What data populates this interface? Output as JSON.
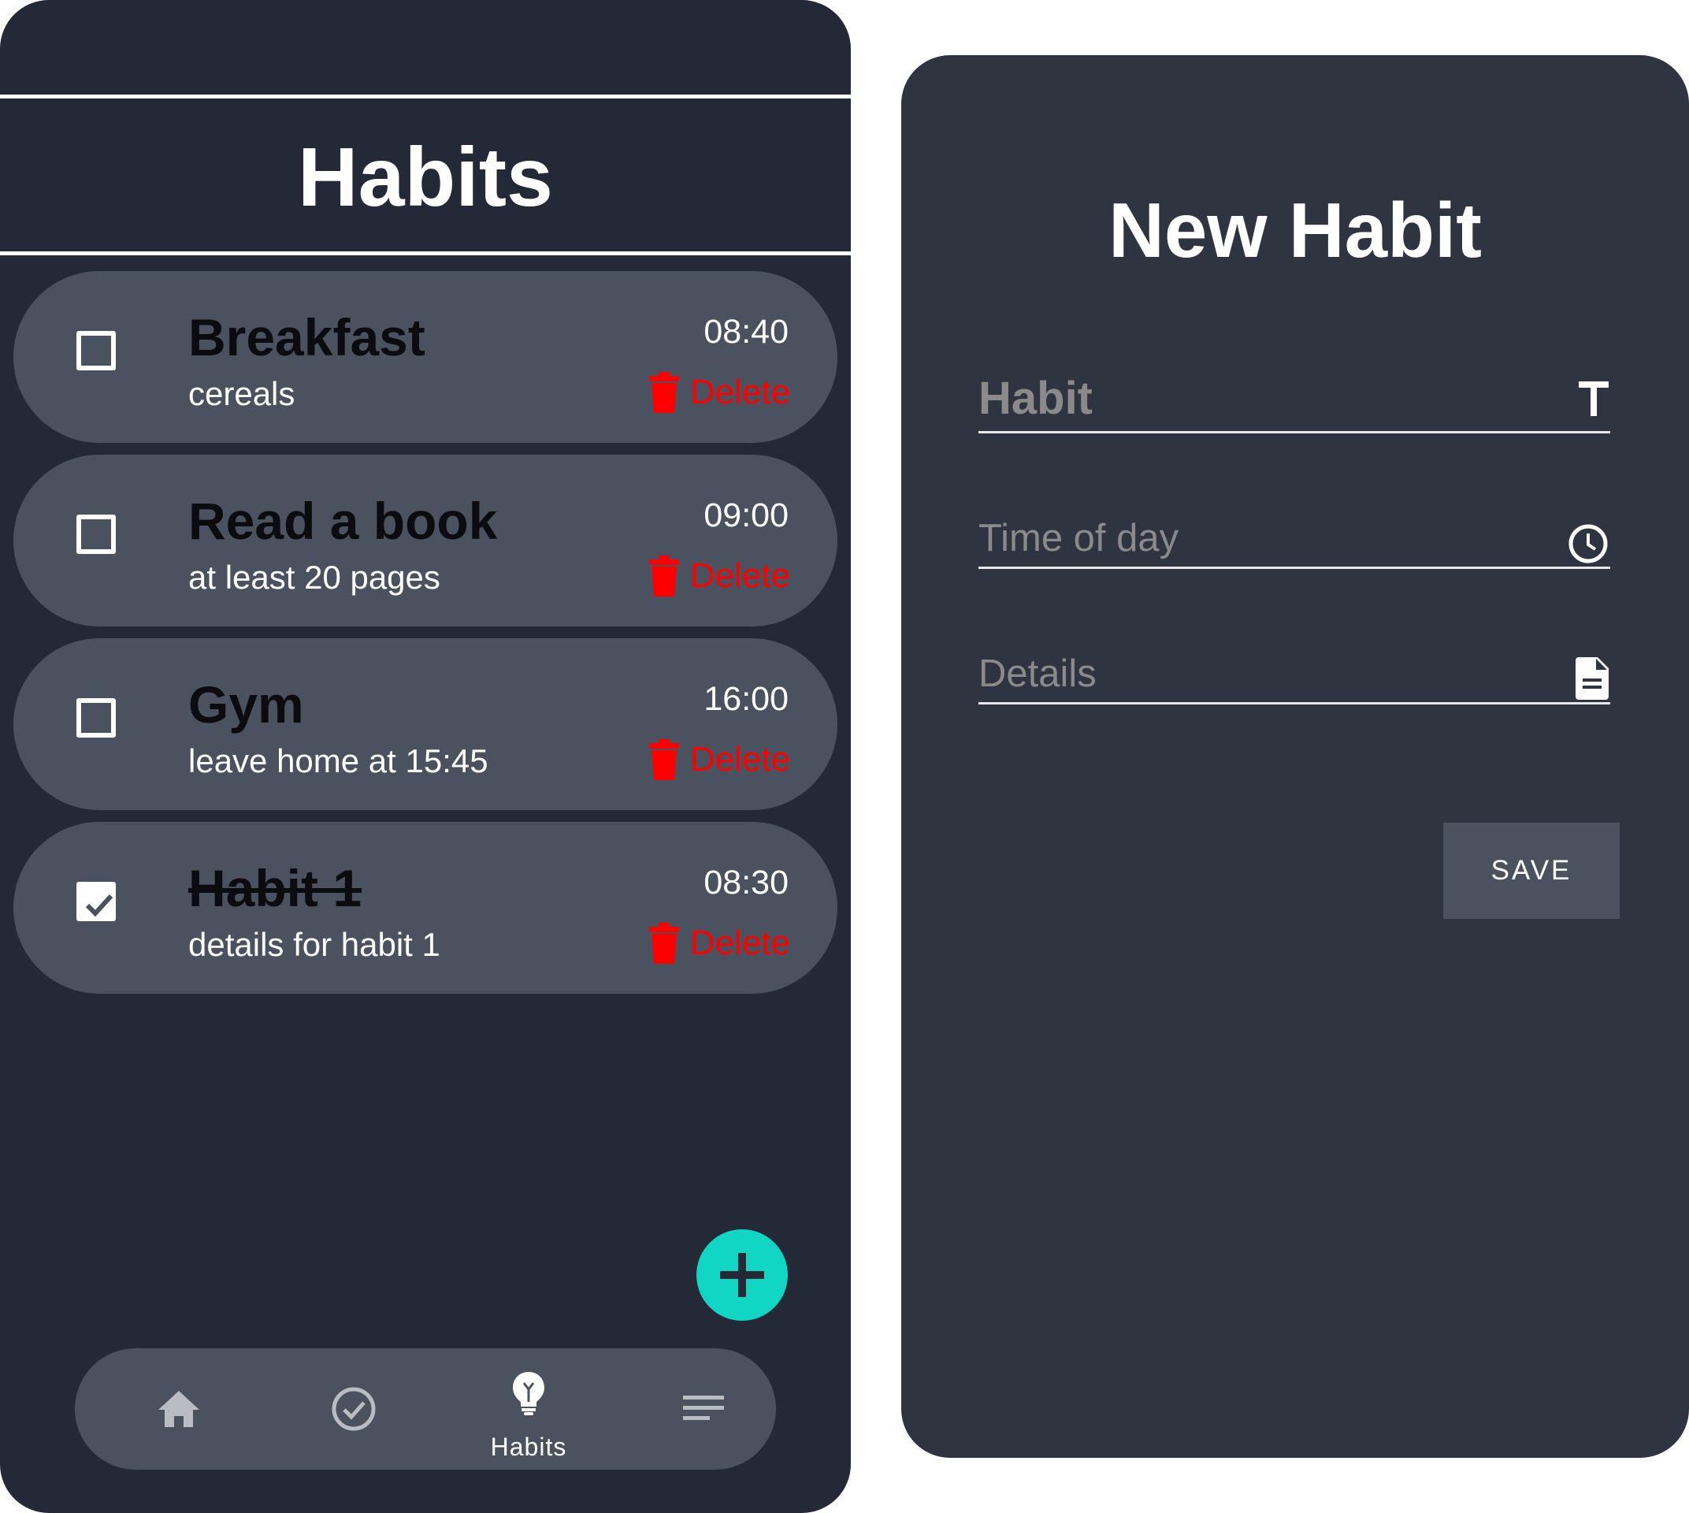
{
  "habits_screen": {
    "title": "Habits",
    "habits": [
      {
        "name": "Breakfast",
        "details": "cereals",
        "time": "08:40",
        "delete_label": "Delete",
        "checked": false
      },
      {
        "name": "Read a book",
        "details": "at least 20 pages",
        "time": "09:00",
        "delete_label": "Delete",
        "checked": false
      },
      {
        "name": "Gym",
        "details": "leave home at 15:45",
        "time": "16:00",
        "delete_label": "Delete",
        "checked": false
      },
      {
        "name": "Habit 1",
        "details": "details for habit 1",
        "time": "08:30",
        "delete_label": "Delete",
        "checked": true
      }
    ],
    "fab_icon": "plus-icon",
    "bottom_nav": {
      "items": [
        {
          "icon": "home-icon",
          "label": ""
        },
        {
          "icon": "check-circle-icon",
          "label": ""
        },
        {
          "icon": "lightbulb-icon",
          "label": "Habits",
          "active": true
        },
        {
          "icon": "menu-lines-icon",
          "label": ""
        }
      ]
    }
  },
  "new_habit_screen": {
    "title": "New Habit",
    "fields": {
      "habit": {
        "placeholder": "Habit",
        "icon": "text-icon"
      },
      "time": {
        "placeholder": "Time of day",
        "icon": "clock-icon"
      },
      "details": {
        "placeholder": "Details",
        "icon": "document-icon"
      }
    },
    "save_label": "SAVE"
  },
  "colors": {
    "left_background": "#232936",
    "right_background": "#2e3440",
    "card": "#4b525f",
    "delete": "#ff0000",
    "fab": "#12d6c4"
  }
}
